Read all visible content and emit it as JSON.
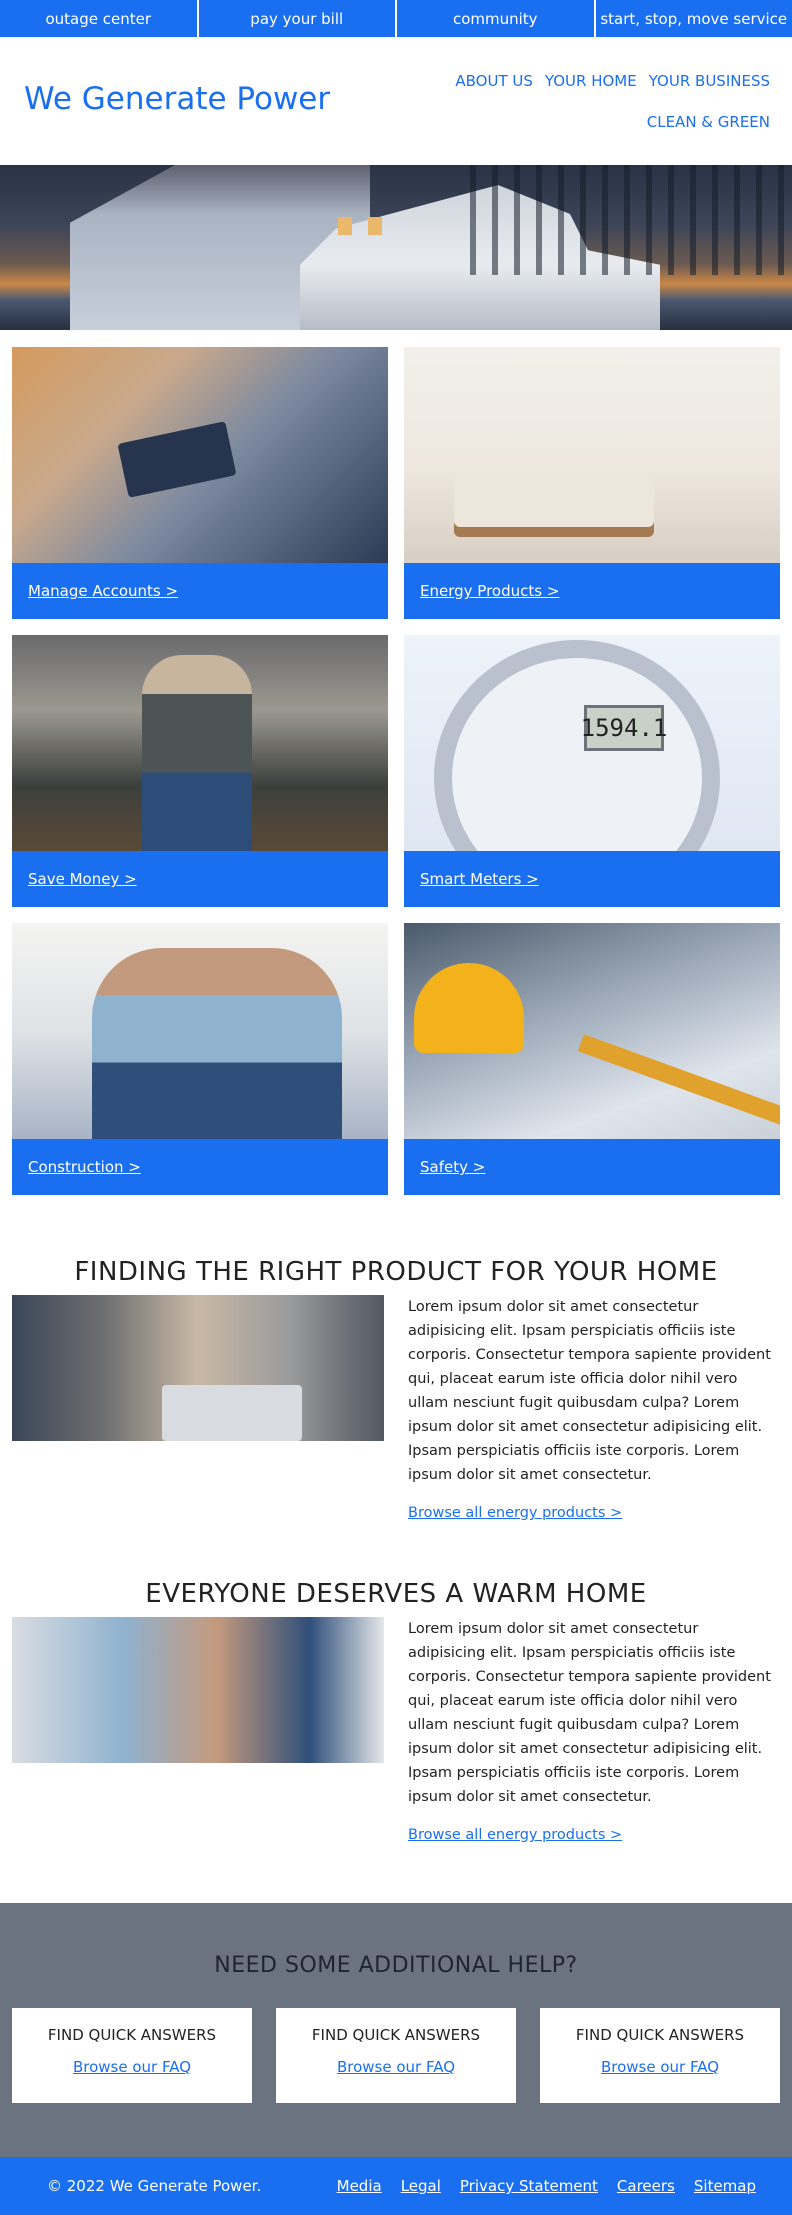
{
  "topbar": {
    "items": [
      "outage center",
      "pay your bill",
      "community",
      "start, stop, move service"
    ]
  },
  "header": {
    "logo": "We Generate Power",
    "nav": [
      "ABOUT US",
      "YOUR HOME",
      "YOUR BUSINESS",
      "CLEAN & GREEN"
    ]
  },
  "tiles": [
    {
      "label": "Manage Accounts >",
      "image": "hand-card-laptop-image"
    },
    {
      "label": "Energy Products >",
      "image": "living-room-image"
    },
    {
      "label": "Save Money >",
      "image": "couple-walking-image"
    },
    {
      "label": "Smart Meters >",
      "image": "smart-meter-image",
      "meter_reading": "1594.1"
    },
    {
      "label": "Construction >",
      "image": "family-couch-image"
    },
    {
      "label": "Safety >",
      "image": "hard-hat-blueprint-image"
    }
  ],
  "features": [
    {
      "title": "FINDING THE RIGHT PRODUCT FOR YOUR HOME",
      "text": "Lorem ipsum dolor sit amet consectetur adipisicing elit. Ipsam perspiciatis officiis iste corporis. Consectetur tempora sapiente provident qui, placeat earum iste officia dolor nihil vero ullam nesciunt fugit quibusdam culpa? Lorem ipsum dolor sit amet consectetur adipisicing elit. Ipsam perspiciatis officiis iste corporis. Lorem ipsum dolor sit amet consectetur.",
      "link": "Browse all energy products >"
    },
    {
      "title": "EVERYONE DESERVES A WARM HOME",
      "text": "Lorem ipsum dolor sit amet consectetur adipisicing elit. Ipsam perspiciatis officiis iste corporis. Consectetur tempora sapiente provident qui, placeat earum iste officia dolor nihil vero ullam nesciunt fugit quibusdam culpa? Lorem ipsum dolor sit amet consectetur adipisicing elit. Ipsam perspiciatis officiis iste corporis. Lorem ipsum dolor sit amet consectetur.",
      "link": "Browse all energy products >"
    }
  ],
  "help": {
    "title": "NEED SOME ADDITIONAL HELP?",
    "cards": [
      {
        "title": "FIND QUICK ANSWERS",
        "link": "Browse our FAQ"
      },
      {
        "title": "FIND QUICK ANSWERS",
        "link": "Browse our FAQ"
      },
      {
        "title": "FIND QUICK ANSWERS",
        "link": "Browse our FAQ"
      }
    ]
  },
  "footer": {
    "copyright": "© 2022 We Generate Power.",
    "links": [
      "Media",
      "Legal",
      "Privacy Statement",
      "Careers",
      "Sitemap"
    ]
  },
  "colors": {
    "brand_blue": "#1a6ff0",
    "help_bg": "#6b7380",
    "text_dark": "#222222"
  }
}
